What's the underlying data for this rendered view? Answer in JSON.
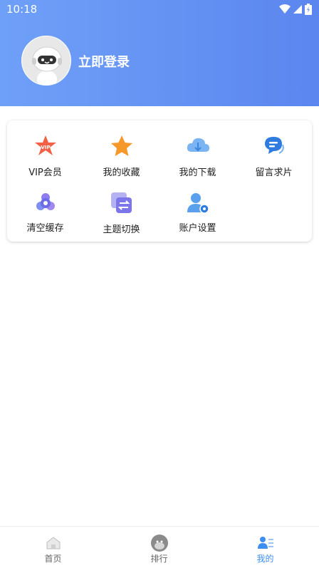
{
  "status_bar": {
    "time": "10:18"
  },
  "profile": {
    "login_label": "立即登录"
  },
  "menu": {
    "items": [
      {
        "label": "VIP会员",
        "icon": "vip-star-icon"
      },
      {
        "label": "我的收藏",
        "icon": "star-icon"
      },
      {
        "label": "我的下载",
        "icon": "cloud-download-icon"
      },
      {
        "label": "留言求片",
        "icon": "message-icon"
      },
      {
        "label": "清空缓存",
        "icon": "clear-cache-icon"
      },
      {
        "label": "主题切换",
        "icon": "theme-switch-icon"
      },
      {
        "label": "账户设置",
        "icon": "account-settings-icon"
      }
    ]
  },
  "bottom_nav": {
    "tabs": [
      {
        "label": "首页",
        "icon": "home-icon",
        "active": false
      },
      {
        "label": "排行",
        "icon": "ranking-icon",
        "active": false
      },
      {
        "label": "我的",
        "icon": "profile-icon",
        "active": true
      }
    ]
  },
  "colors": {
    "header_start": "#6fa0f8",
    "header_end": "#5b86ef",
    "active_tab": "#3d8ef3"
  }
}
